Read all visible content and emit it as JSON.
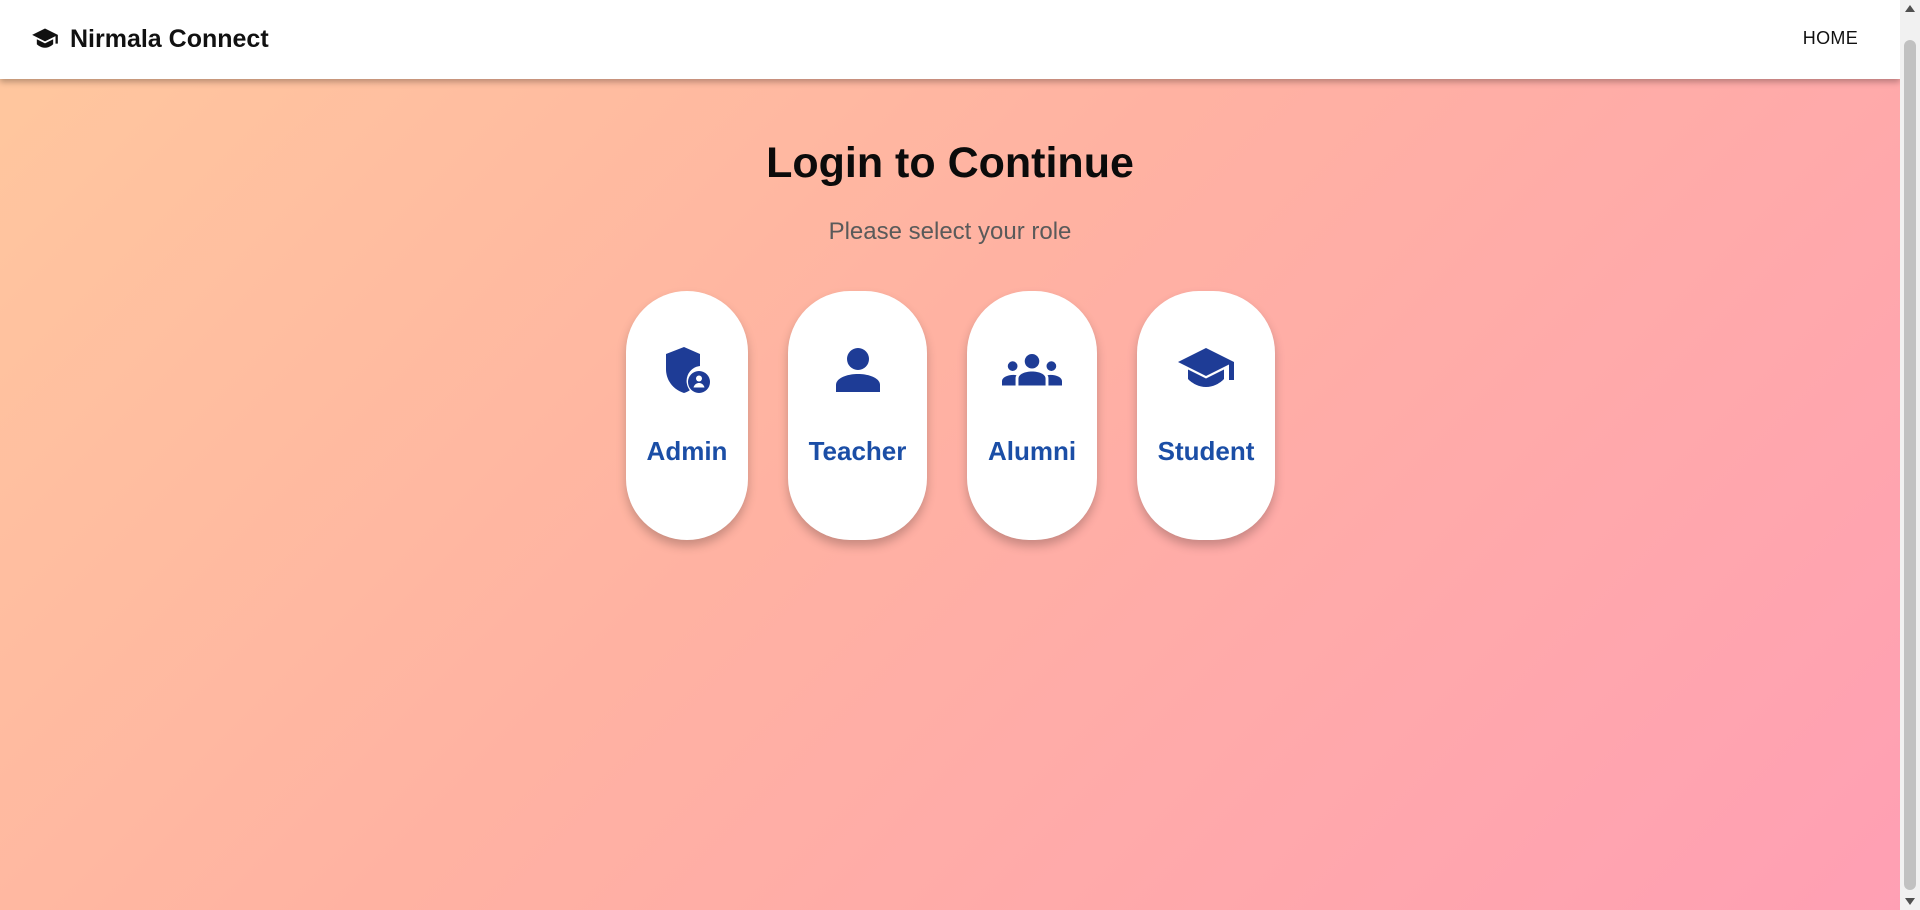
{
  "navbar": {
    "brand_icon": "graduation-cap-icon",
    "brand_name": "Nirmala Connect",
    "home_link": "HOME"
  },
  "main": {
    "title": "Login to Continue",
    "subtitle": "Please select your role",
    "roles": [
      {
        "label": "Admin",
        "icon": "admin-shield-user-icon"
      },
      {
        "label": "Teacher",
        "icon": "person-icon"
      },
      {
        "label": "Alumni",
        "icon": "group-icon"
      },
      {
        "label": "Student",
        "icon": "graduation-cap-icon"
      }
    ]
  },
  "colors": {
    "accent": "#1b4ea6",
    "icon": "#1e3c96",
    "gradient_start": "#ffc89e",
    "gradient_end": "#ff9fb4",
    "card_bg": "#ffffff"
  }
}
